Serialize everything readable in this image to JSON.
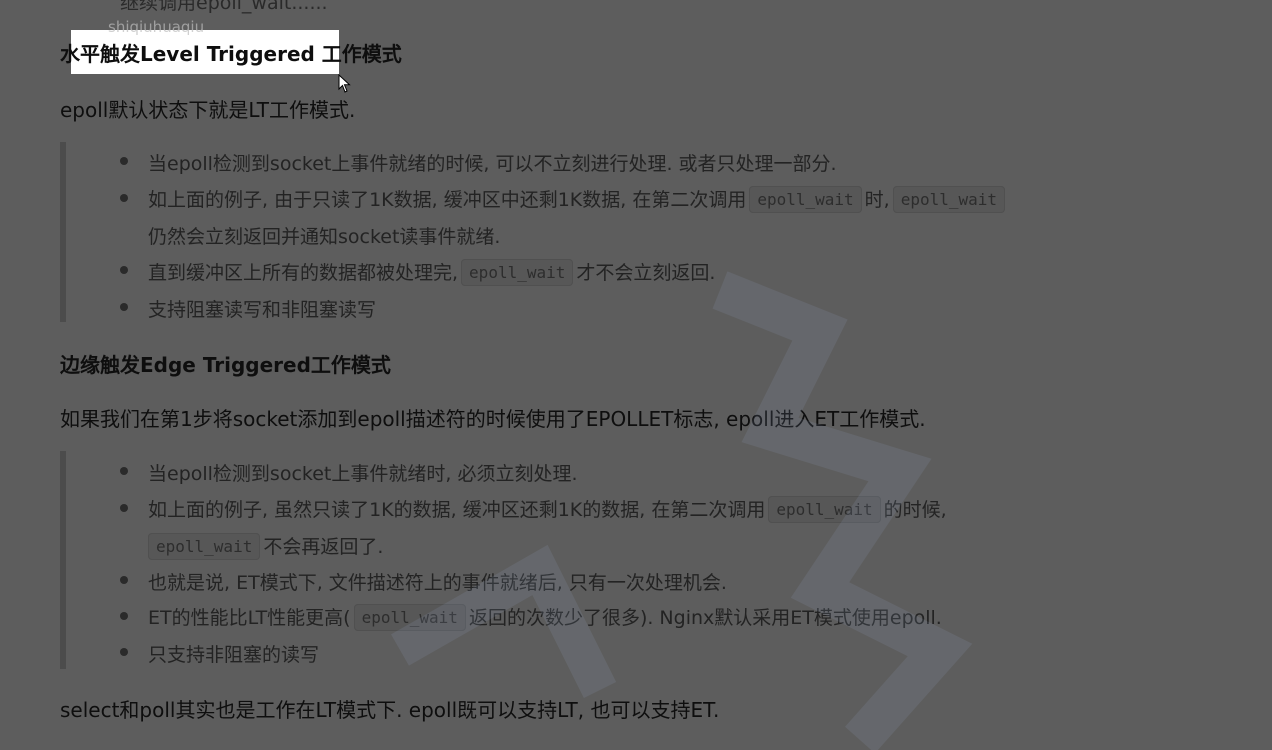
{
  "watermark_text": "shiqiuhuaqiu",
  "previous_item": "继续调用epoll_wait......",
  "section1": {
    "title": "水平触发Level Triggered 工作模式",
    "intro": "epoll默认状态下就是LT工作模式.",
    "items": [
      "当epoll检测到socket上事件就绪的时候, 可以不立刻进行处理. 或者只处理一部分.",
      "如上面的例子, 由于只读了1K数据, 缓冲区中还剩1K数据, 在第二次调用",
      "时,",
      "仍然会立刻返回并通知socket读事件就绪.",
      "直到缓冲区上所有的数据都被处理完,",
      "才不会立刻返回.",
      "支持阻塞读写和非阻塞读写"
    ],
    "code": "epoll_wait"
  },
  "section2": {
    "title": "边缘触发Edge Triggered工作模式",
    "intro": "如果我们在第1步将socket添加到epoll描述符的时候使用了EPOLLET标志, epoll进入ET工作模式.",
    "items": [
      "当epoll检测到socket上事件就绪时, 必须立刻处理.",
      "如上面的例子, 虽然只读了1K的数据, 缓冲区还剩1K的数据, 在第二次调用",
      "的时候,",
      "不会再返回了.",
      "也就是说, ET模式下, 文件描述符上的事件就绪后, 只有一次处理机会.",
      "ET的性能比LT性能更高(",
      "返回的次数少了很多). Nginx默认采用ET模式使用epoll.",
      "只支持非阻塞的读写"
    ],
    "code": "epoll_wait"
  },
  "closing": "select和poll其实也是工作在LT模式下. epoll既可以支持LT, 也可以支持ET.",
  "colors": {
    "dim_background": "#5d5d5d",
    "highlight": "#ffffff"
  }
}
